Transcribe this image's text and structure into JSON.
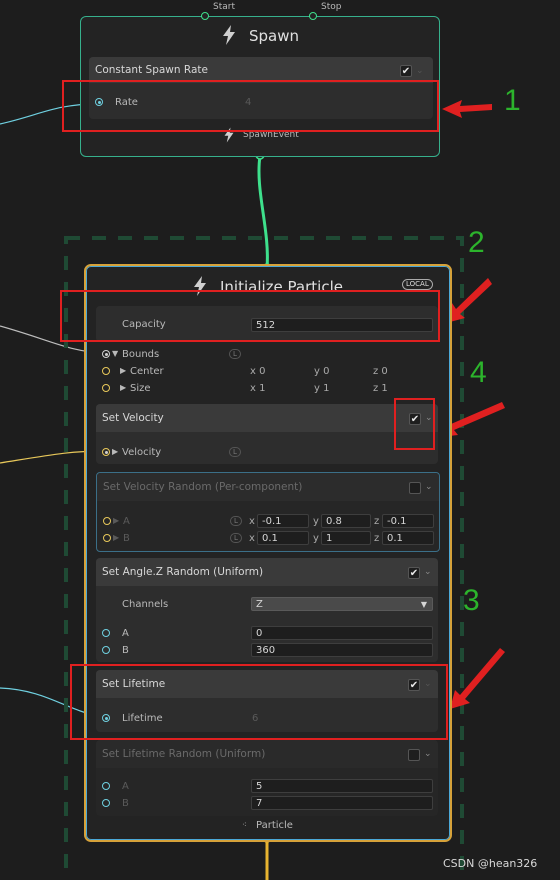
{
  "spawn_node": {
    "title": "Spawn",
    "port_start": "Start",
    "port_stop": "Stop",
    "block_title": "Constant Spawn Rate",
    "block_checked": true,
    "rate_label": "Rate",
    "rate_value": "4",
    "output_label": "SpawnEvent"
  },
  "init_node": {
    "title": "Initialize Particle",
    "local_badge": "LOCAL",
    "capacity_label": "Capacity",
    "capacity_value": "512",
    "bounds_label": "Bounds",
    "center_label": "Center",
    "size_label": "Size",
    "center_values": {
      "x": "x 0",
      "y": "y 0",
      "z": "z 0"
    },
    "size_values": {
      "x": "x 1",
      "y": "y 1",
      "z": "z 1"
    },
    "l_badge": "L",
    "blocks": {
      "set_velocity": {
        "title": "Set Velocity",
        "checked": true,
        "field_label": "Velocity"
      },
      "set_velocity_random": {
        "title": "Set Velocity Random (Per-component)",
        "checked": false,
        "a_label": "A",
        "b_label": "B",
        "a": {
          "x": "-0.1",
          "y": "0.8",
          "z": "-0.1"
        },
        "b": {
          "x": "0.1",
          "y": "1",
          "z": "0.1"
        }
      },
      "set_angle_random": {
        "title": "Set Angle.Z Random (Uniform)",
        "checked": true,
        "channels_label": "Channels",
        "channels_value": "Z",
        "a_label": "A",
        "a_value": "0",
        "b_label": "B",
        "b_value": "360"
      },
      "set_lifetime": {
        "title": "Set Lifetime",
        "checked": true,
        "field_label": "Lifetime",
        "field_value": "6"
      },
      "set_lifetime_random": {
        "title": "Set Lifetime Random (Uniform)",
        "checked": false,
        "a_label": "A",
        "a_value": "5",
        "b_label": "B",
        "b_value": "7"
      }
    },
    "output_label": "Particle"
  },
  "annotations": {
    "n1": "1",
    "n2": "2",
    "n3": "3",
    "n4": "4"
  },
  "axis_prefix": {
    "x": "x",
    "y": "y",
    "z": "z"
  },
  "watermark": "CSDN @hean326",
  "colors": {
    "spawn_border": "#36b08c",
    "init_border": "#4aa8d8",
    "init_border_outer": "#d6a23a",
    "annotation_red": "#e02020",
    "annotation_green": "#2cb42c"
  }
}
